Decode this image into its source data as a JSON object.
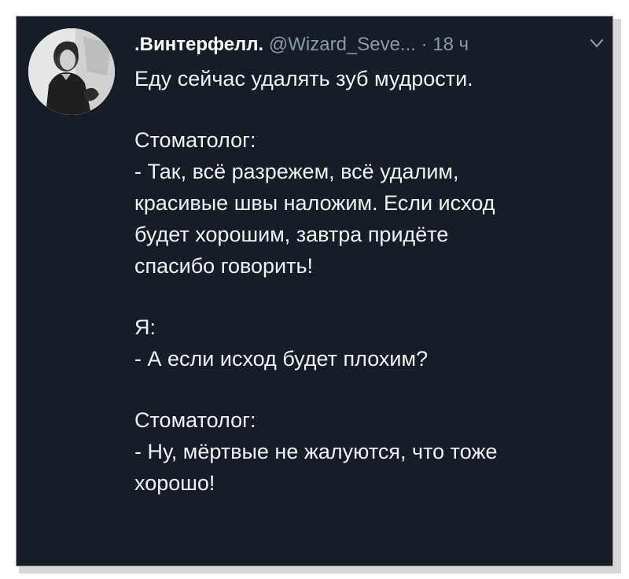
{
  "tweet": {
    "author_name": ".Винтерфелл.",
    "author_handle": "@Wizard_Seve...",
    "separator": "·",
    "timestamp": "18 ч",
    "menu_icon": "chevron-down-icon",
    "avatar_icon": "user-avatar",
    "paragraphs": [
      [
        "Еду сейчас удалять зуб мудрости."
      ],
      [
        "Стоматолог:",
        "- Так, всё разрежем, всё удалим,",
        "красивые швы наложим. Если исход",
        "будет хорошим, завтра придёте",
        "спасибо говорить!"
      ],
      [
        "Я:",
        "- А если исход будет плохим?"
      ],
      [
        "Стоматолог:",
        "- Ну, мёртвые не жалуются, что тоже",
        "хорошо!"
      ]
    ]
  },
  "colors": {
    "background": "#161d26",
    "text": "#f2f2f2",
    "muted": "#8b98a5",
    "frame": "#ffffff"
  }
}
